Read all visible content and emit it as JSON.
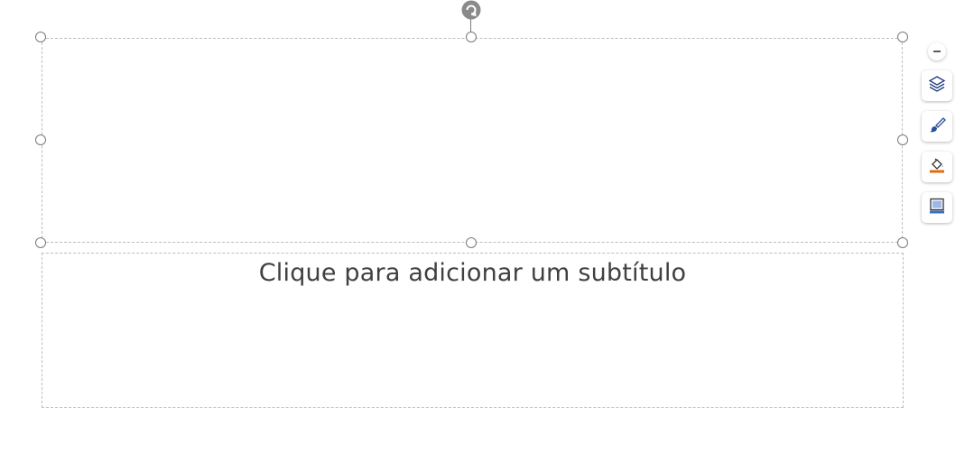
{
  "slide": {
    "subtitle_placeholder": "Clique para adicionar um subtítulo"
  },
  "toolbar": {
    "items": [
      {
        "icon": "collapse-minus-icon"
      },
      {
        "icon": "layers-icon"
      },
      {
        "icon": "brush-icon"
      },
      {
        "icon": "fill-color-icon",
        "color": "#E36C0A"
      },
      {
        "icon": "shape-outline-icon",
        "color": "#3B6EC4"
      }
    ]
  },
  "colors": {
    "handle_border": "#7A7A7A",
    "placeholder_border": "#BDBDBD",
    "text": "#404040",
    "rotate_handle": "#8A8A8A"
  }
}
